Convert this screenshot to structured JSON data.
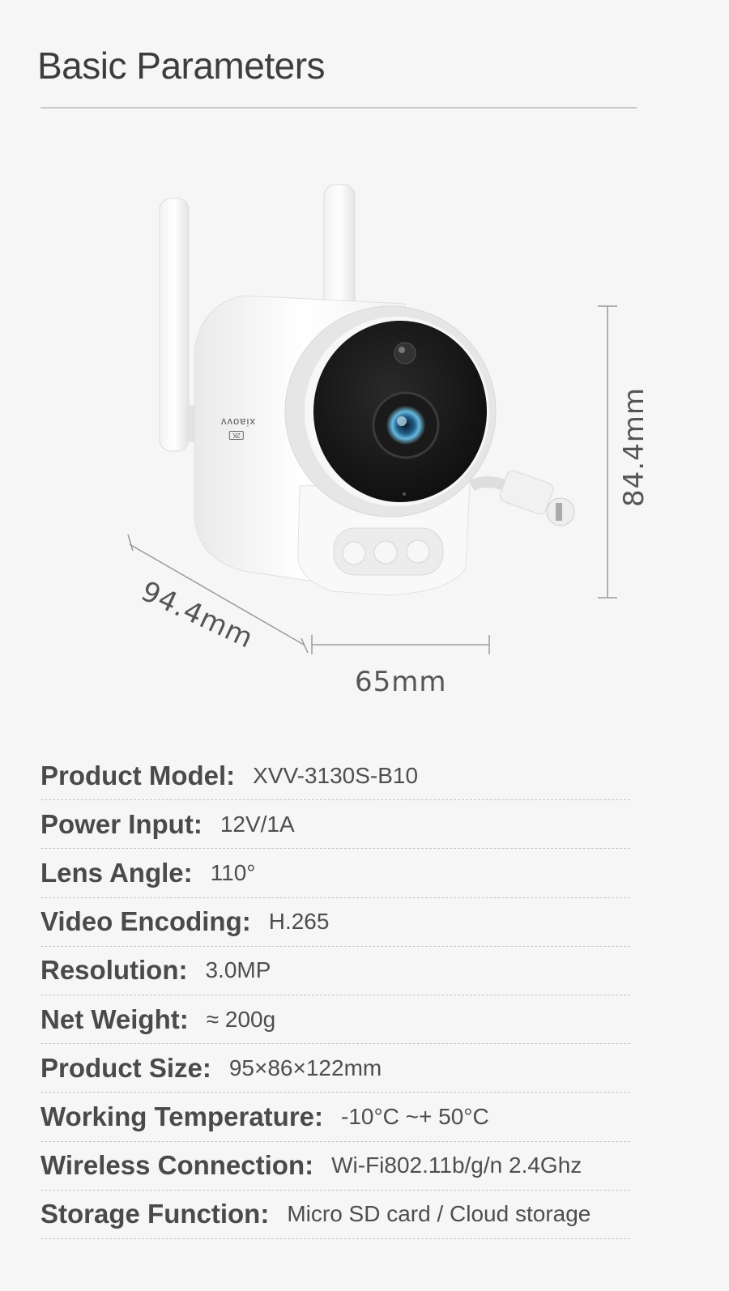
{
  "page_title": "Basic Parameters",
  "product_image": {
    "brand": "xiaovv",
    "badge": "2K"
  },
  "dimensions": {
    "height": "84.4mm",
    "width": "65mm",
    "depth": "94.4mm"
  },
  "specs": [
    {
      "label": "Product Model:",
      "value": "XVV-3130S-B10"
    },
    {
      "label": "Power Input:",
      "value": "12V/1A"
    },
    {
      "label": "Lens Angle:",
      "value": "110°"
    },
    {
      "label": "Video Encoding:",
      "value": "H.265"
    },
    {
      "label": "Resolution:",
      "value": "3.0MP"
    },
    {
      "label": "Net Weight:",
      "value": "≈ 200g"
    },
    {
      "label": "Product Size:",
      "value": "95×86×122mm"
    },
    {
      "label": "Working Temperature:",
      "value": "-10°C ~+ 50°C"
    },
    {
      "label": "Wireless Connection:",
      "value": "Wi-Fi802.11b/g/n 2.4Ghz"
    },
    {
      "label": "Storage Function:",
      "value": "Micro SD card / Cloud storage"
    }
  ]
}
